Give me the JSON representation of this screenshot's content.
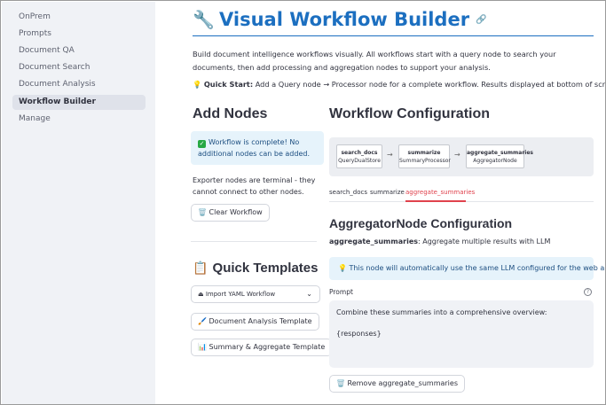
{
  "sidebar": {
    "items": [
      {
        "label": "OnPrem",
        "active": false
      },
      {
        "label": "Prompts",
        "active": false
      },
      {
        "label": "Document QA",
        "active": false
      },
      {
        "label": "Document Search",
        "active": false
      },
      {
        "label": "Document Analysis",
        "active": false
      },
      {
        "label": "Workflow Builder",
        "active": true
      },
      {
        "label": "Manage",
        "active": false
      }
    ]
  },
  "header": {
    "icon": "wrench-icon",
    "title": "Visual Workflow Builder",
    "link_icon": "link-icon",
    "description": "Build document intelligence workflows visually. All workflows start with a query node to search your documents, then add processing and aggregation nodes to support your analysis.",
    "quick_start_label": "Quick Start:",
    "quick_start_text": " Add a Query node → Processor node for a complete workflow. Results displayed at bottom of screen."
  },
  "add_nodes": {
    "heading": "Add Nodes",
    "success_message": "Workflow is complete! No additional nodes can be added.",
    "note": "Exporter nodes are terminal - they cannot connect to other nodes.",
    "clear_button": "Clear Workflow"
  },
  "quick_templates": {
    "heading": "Quick Templates",
    "import_select": "Import YAML Workflow",
    "document_analysis_button": "Document Analysis Template",
    "summary_aggregate_button": "Summary & Aggregate Template"
  },
  "workflow_config": {
    "heading": "Workflow Configuration",
    "nodes": [
      {
        "name": "search_docs",
        "type": "QueryDualStore"
      },
      {
        "name": "summarize",
        "type": "SummaryProcessor"
      },
      {
        "name": "aggregate_summaries",
        "type": "AggregatorNode"
      }
    ],
    "arrow": "→",
    "tabs": [
      {
        "label": "search_docs",
        "active": false
      },
      {
        "label": "summarize",
        "active": false
      },
      {
        "label": "aggregate_summaries",
        "active": true
      }
    ]
  },
  "node_config": {
    "heading": "AggregatorNode Configuration",
    "node_name": "aggregate_summaries",
    "node_desc": ": Aggregate multiple results with LLM",
    "info_message": "This node will automatically use the same LLM configured for the web app.",
    "prompt_label": "Prompt",
    "help_symbol": "?",
    "prompt_value": "Combine these summaries into a comprehensive overview:\n\n{responses}",
    "remove_button": "Remove aggregate_summaries"
  },
  "colors": {
    "title_blue": "#1c6fc0",
    "active_tab_red": "#e0424d",
    "info_bg": "#e6f3fb",
    "sidebar_bg": "#f0f2f6"
  }
}
